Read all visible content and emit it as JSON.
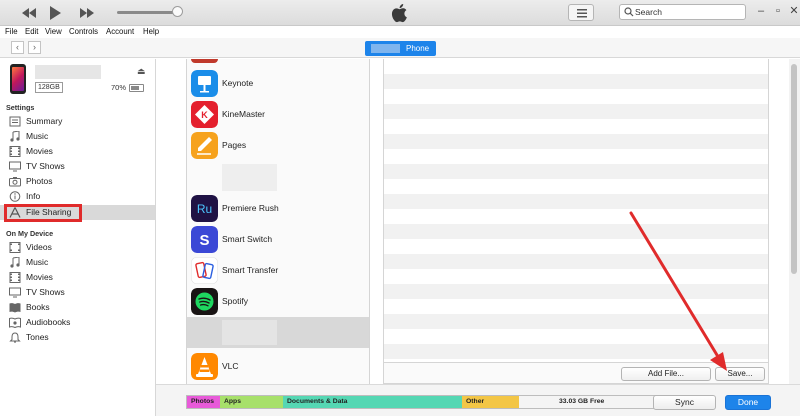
{
  "search": {
    "placeholder": "Search"
  },
  "menu": [
    "File",
    "Edit",
    "View",
    "Controls",
    "Account",
    "Help"
  ],
  "device": {
    "pill_label": "Phone",
    "capacity": "128GB",
    "battery": "70%",
    "battery_level": 0.7
  },
  "sidebar": {
    "settings_heading": "Settings",
    "settings_items": [
      {
        "label": "Summary",
        "icon": "summary-icon"
      },
      {
        "label": "Music",
        "icon": "music-icon"
      },
      {
        "label": "Movies",
        "icon": "movies-icon"
      },
      {
        "label": "TV Shows",
        "icon": "tv-icon"
      },
      {
        "label": "Photos",
        "icon": "camera-icon"
      },
      {
        "label": "Info",
        "icon": "info-icon"
      },
      {
        "label": "File Sharing",
        "icon": "apps-icon"
      }
    ],
    "device_heading": "On My Device",
    "device_items": [
      {
        "label": "Videos"
      },
      {
        "label": "Music"
      },
      {
        "label": "Movies"
      },
      {
        "label": "TV Shows"
      },
      {
        "label": "Books"
      },
      {
        "label": "Audiobooks"
      },
      {
        "label": "Tones"
      }
    ]
  },
  "apps": [
    {
      "label": "Keynote",
      "color": "#1a8de9"
    },
    {
      "label": "KineMaster",
      "color": "#e4202d"
    },
    {
      "label": "Pages",
      "color": "#f6a21d"
    },
    {
      "label": "Premiere Rush",
      "color": "#1f1244"
    },
    {
      "label": "Smart Switch",
      "color": "#3b48d6"
    },
    {
      "label": "Smart Transfer",
      "color": "#ffffff"
    },
    {
      "label": "Spotify",
      "color": "#1ed760"
    },
    {
      "label": "VLC",
      "color": "#ff8800"
    }
  ],
  "icons": {
    "ru_text": "Ru",
    "s_text": "S"
  },
  "files": {
    "add_label": "Add File...",
    "save_label": "Save..."
  },
  "storage": [
    {
      "label": "Photos",
      "color": "#e85ad9"
    },
    {
      "label": "Apps",
      "color": "#a7e06a"
    },
    {
      "label": "Documents & Data",
      "color": "#55d7b3"
    },
    {
      "label": "Other",
      "color": "#f3c646"
    },
    {
      "label": "33.03 GB Free",
      "color": "#f4f4f4"
    }
  ],
  "bottom": {
    "sync_label": "Sync",
    "done_label": "Done"
  },
  "annotation_color": "#e02b2b"
}
